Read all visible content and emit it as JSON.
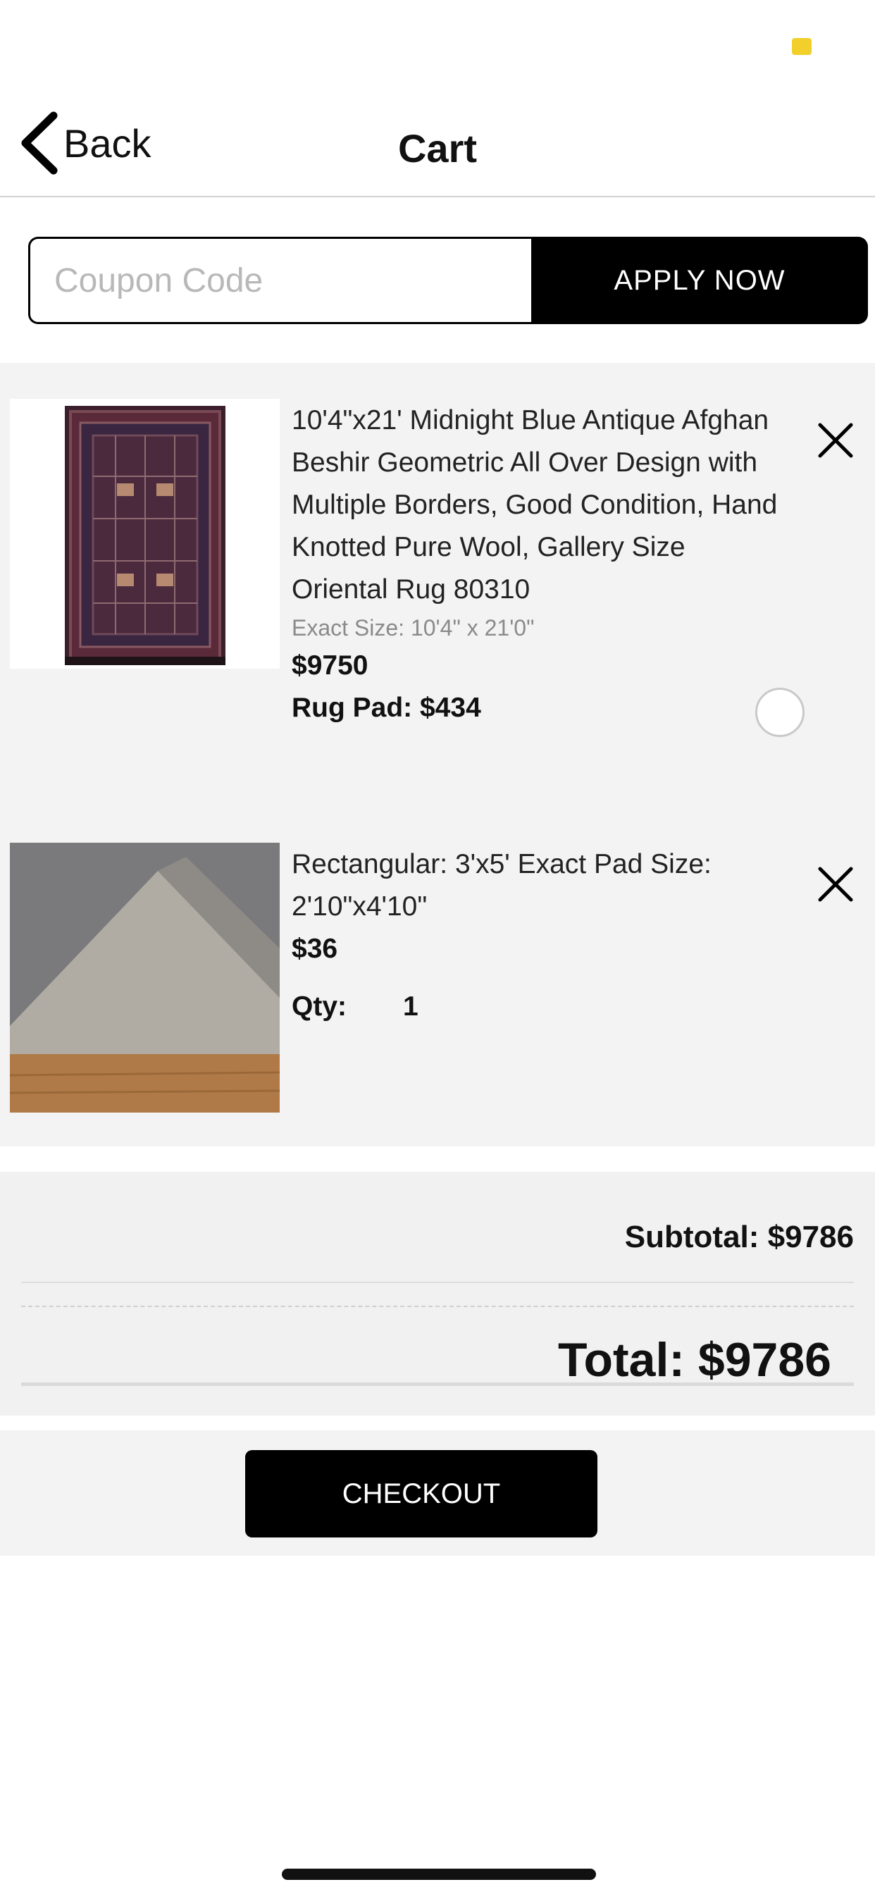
{
  "header": {
    "back_label": "Back",
    "title": "Cart"
  },
  "coupon": {
    "placeholder": "Coupon Code",
    "value": "",
    "apply_label": "APPLY NOW"
  },
  "items": [
    {
      "name": "10'4\"x21' Midnight Blue Antique Afghan Beshir Geometric All Over Design with Multiple Borders, Good Condition, Hand Knotted Pure Wool, Gallery Size Oriental Rug 80310",
      "exact_size": "Exact Size: 10'4\" x 21'0\"",
      "price": "$9750",
      "rug_pad": "Rug Pad: $434",
      "rug_pad_selected": false
    },
    {
      "name": "Rectangular: 3'x5' Exact Pad Size: 2'10\"x4'10\"",
      "price": "$36",
      "qty_label": "Qty:",
      "qty_value": "1"
    }
  ],
  "totals": {
    "subtotal": "Subtotal: $9786",
    "total": "Total: $9786"
  },
  "checkout_label": "CHECKOUT",
  "colors": {
    "accent": "#000000",
    "status_dot": "#f2cf2a",
    "list_bg": "#f3f3f3"
  },
  "icons": [
    "chevron-left-icon",
    "close-icon"
  ]
}
